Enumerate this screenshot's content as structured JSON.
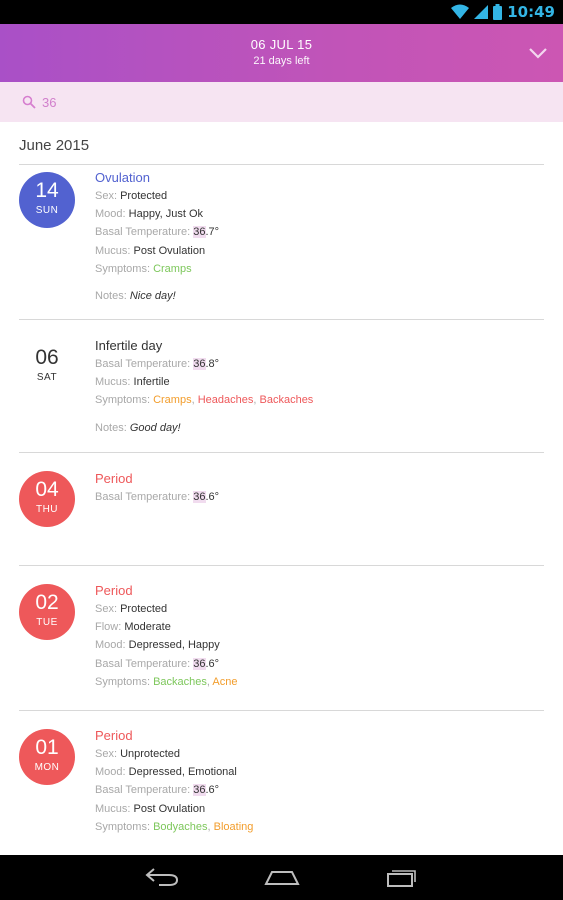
{
  "status": {
    "time": "10:49"
  },
  "header": {
    "date": "06 JUL 15",
    "days_left": "21 days left"
  },
  "search": {
    "value": "36",
    "placeholder": ""
  },
  "month": "June 2015",
  "colors": {
    "ovulation": "#5262d0",
    "period": "#ee585a",
    "header": "#b953bd"
  },
  "entries": [
    {
      "day": "14",
      "dow": "SUN",
      "title": "Ovulation",
      "sex_label": "Sex:",
      "sex": "Protected",
      "mood_label": "Mood:",
      "mood": "Happy, Just Ok",
      "temp_label": "Basal Temperature:",
      "temp_hl": "36",
      "temp_rest": ".7°",
      "mucus_label": "Mucus:",
      "mucus": "Post Ovulation",
      "symptoms_label": "Symptoms:",
      "symptom1": "Cramps",
      "notes_label": "Notes:",
      "notes": "Nice day!"
    },
    {
      "day": "06",
      "dow": "SAT",
      "title": "Infertile day",
      "temp_label": "Basal Temperature:",
      "temp_hl": "36",
      "temp_rest": ".8°",
      "mucus_label": "Mucus:",
      "mucus": "Infertile",
      "symptoms_label": "Symptoms:",
      "symptom1": "Cramps",
      "symptom2": "Headaches",
      "symptom3": "Backaches",
      "notes_label": "Notes:",
      "notes": "Good day!"
    },
    {
      "day": "04",
      "dow": "THU",
      "title": "Period",
      "temp_label": "Basal Temperature:",
      "temp_hl": "36",
      "temp_rest": ".6°"
    },
    {
      "day": "02",
      "dow": "TUE",
      "title": "Period",
      "sex_label": "Sex:",
      "sex": "Protected",
      "flow_label": "Flow:",
      "flow": "Moderate",
      "mood_label": "Mood:",
      "mood": "Depressed, Happy",
      "temp_label": "Basal Temperature:",
      "temp_hl": "36",
      "temp_rest": ".6°",
      "symptoms_label": "Symptoms:",
      "symptom1": "Backaches",
      "symptom2": "Acne"
    },
    {
      "day": "01",
      "dow": "MON",
      "title": "Period",
      "sex_label": "Sex:",
      "sex": "Unprotected",
      "mood_label": "Mood:",
      "mood": "Depressed, Emotional",
      "temp_label": "Basal Temperature:",
      "temp_hl": "36",
      "temp_rest": ".6°",
      "mucus_label": "Mucus:",
      "mucus": "Post Ovulation",
      "symptoms_label": "Symptoms:",
      "symptom1": "Bodyaches",
      "symptom2": "Bloating"
    }
  ]
}
